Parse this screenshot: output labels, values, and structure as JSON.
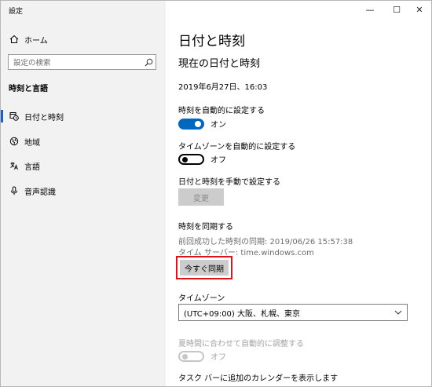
{
  "window": {
    "title": "設定",
    "controls": {
      "minimize": "—",
      "maximize": "☐",
      "close": "✕"
    }
  },
  "sidebar": {
    "home_label": "ホーム",
    "search_placeholder": "設定の検索",
    "section_title": "時刻と言語",
    "items": [
      {
        "label": "日付と時刻",
        "icon": "calendar-clock-icon",
        "active": true
      },
      {
        "label": "地域",
        "icon": "globe-icon",
        "active": false
      },
      {
        "label": "言語",
        "icon": "language-icon",
        "active": false
      },
      {
        "label": "音声認識",
        "icon": "microphone-icon",
        "active": false
      }
    ]
  },
  "main": {
    "page_title": "日付と時刻",
    "current_heading": "現在の日付と時刻",
    "current_datetime": "2019年6月27日、16:03",
    "auto_time": {
      "label": "時刻を自動的に設定する",
      "state": "オン",
      "on": true
    },
    "auto_timezone": {
      "label": "タイムゾーンを自動的に設定する",
      "state": "オフ",
      "on": false
    },
    "manual": {
      "label": "日付と時刻を手動で設定する",
      "button": "変更"
    },
    "sync": {
      "heading": "時刻を同期する",
      "last_sync": "前回成功した時刻の同期: 2019/06/26 15:57:38",
      "server": "タイム サーバー: time.windows.com",
      "button": "今すぐ同期"
    },
    "timezone": {
      "label": "タイムゾーン",
      "value": "(UTC+09:00) 大阪、札幌、東京"
    },
    "dst": {
      "label": "夏時間に合わせて自動的に調整する",
      "state": "オフ",
      "enabled": false
    },
    "taskbar_calendar_label": "タスク バーに追加のカレンダーを表示します"
  },
  "colors": {
    "accent": "#0067c0",
    "sidebar_bg": "#f2f2f2",
    "highlight_border": "#e0121a",
    "button_bg": "#cccccc"
  }
}
